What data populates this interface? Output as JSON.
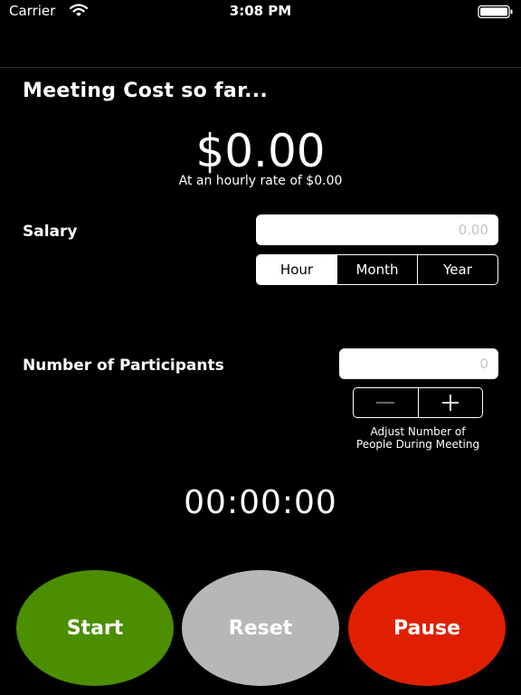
{
  "status_bar": {
    "carrier": "Carrier",
    "time": "3:08 PM",
    "icons": [
      "wifi-icon",
      "battery-icon"
    ]
  },
  "meeting": {
    "heading": "Meeting Cost so far...",
    "cost": "$0.00",
    "rate_line": "At an hourly rate of $0.00"
  },
  "salary": {
    "label": "Salary",
    "placeholder": "0.00",
    "segments": [
      "Hour",
      "Month",
      "Year"
    ],
    "selected_segment": "Hour"
  },
  "participants": {
    "label": "Number of Participants",
    "placeholder": "0",
    "stepper_icons": [
      "minus-icon",
      "plus-icon"
    ],
    "adjust_note_line1": "Adjust Number of",
    "adjust_note_line2": "People During Meeting"
  },
  "timer": {
    "display": "00:00:00"
  },
  "controls": {
    "start_label": "Start",
    "reset_label": "Reset",
    "pause_label": "Pause"
  },
  "colors": {
    "background": "#000000",
    "start": "#4b8e00",
    "reset": "#b7b7b7",
    "pause": "#e01f00"
  }
}
